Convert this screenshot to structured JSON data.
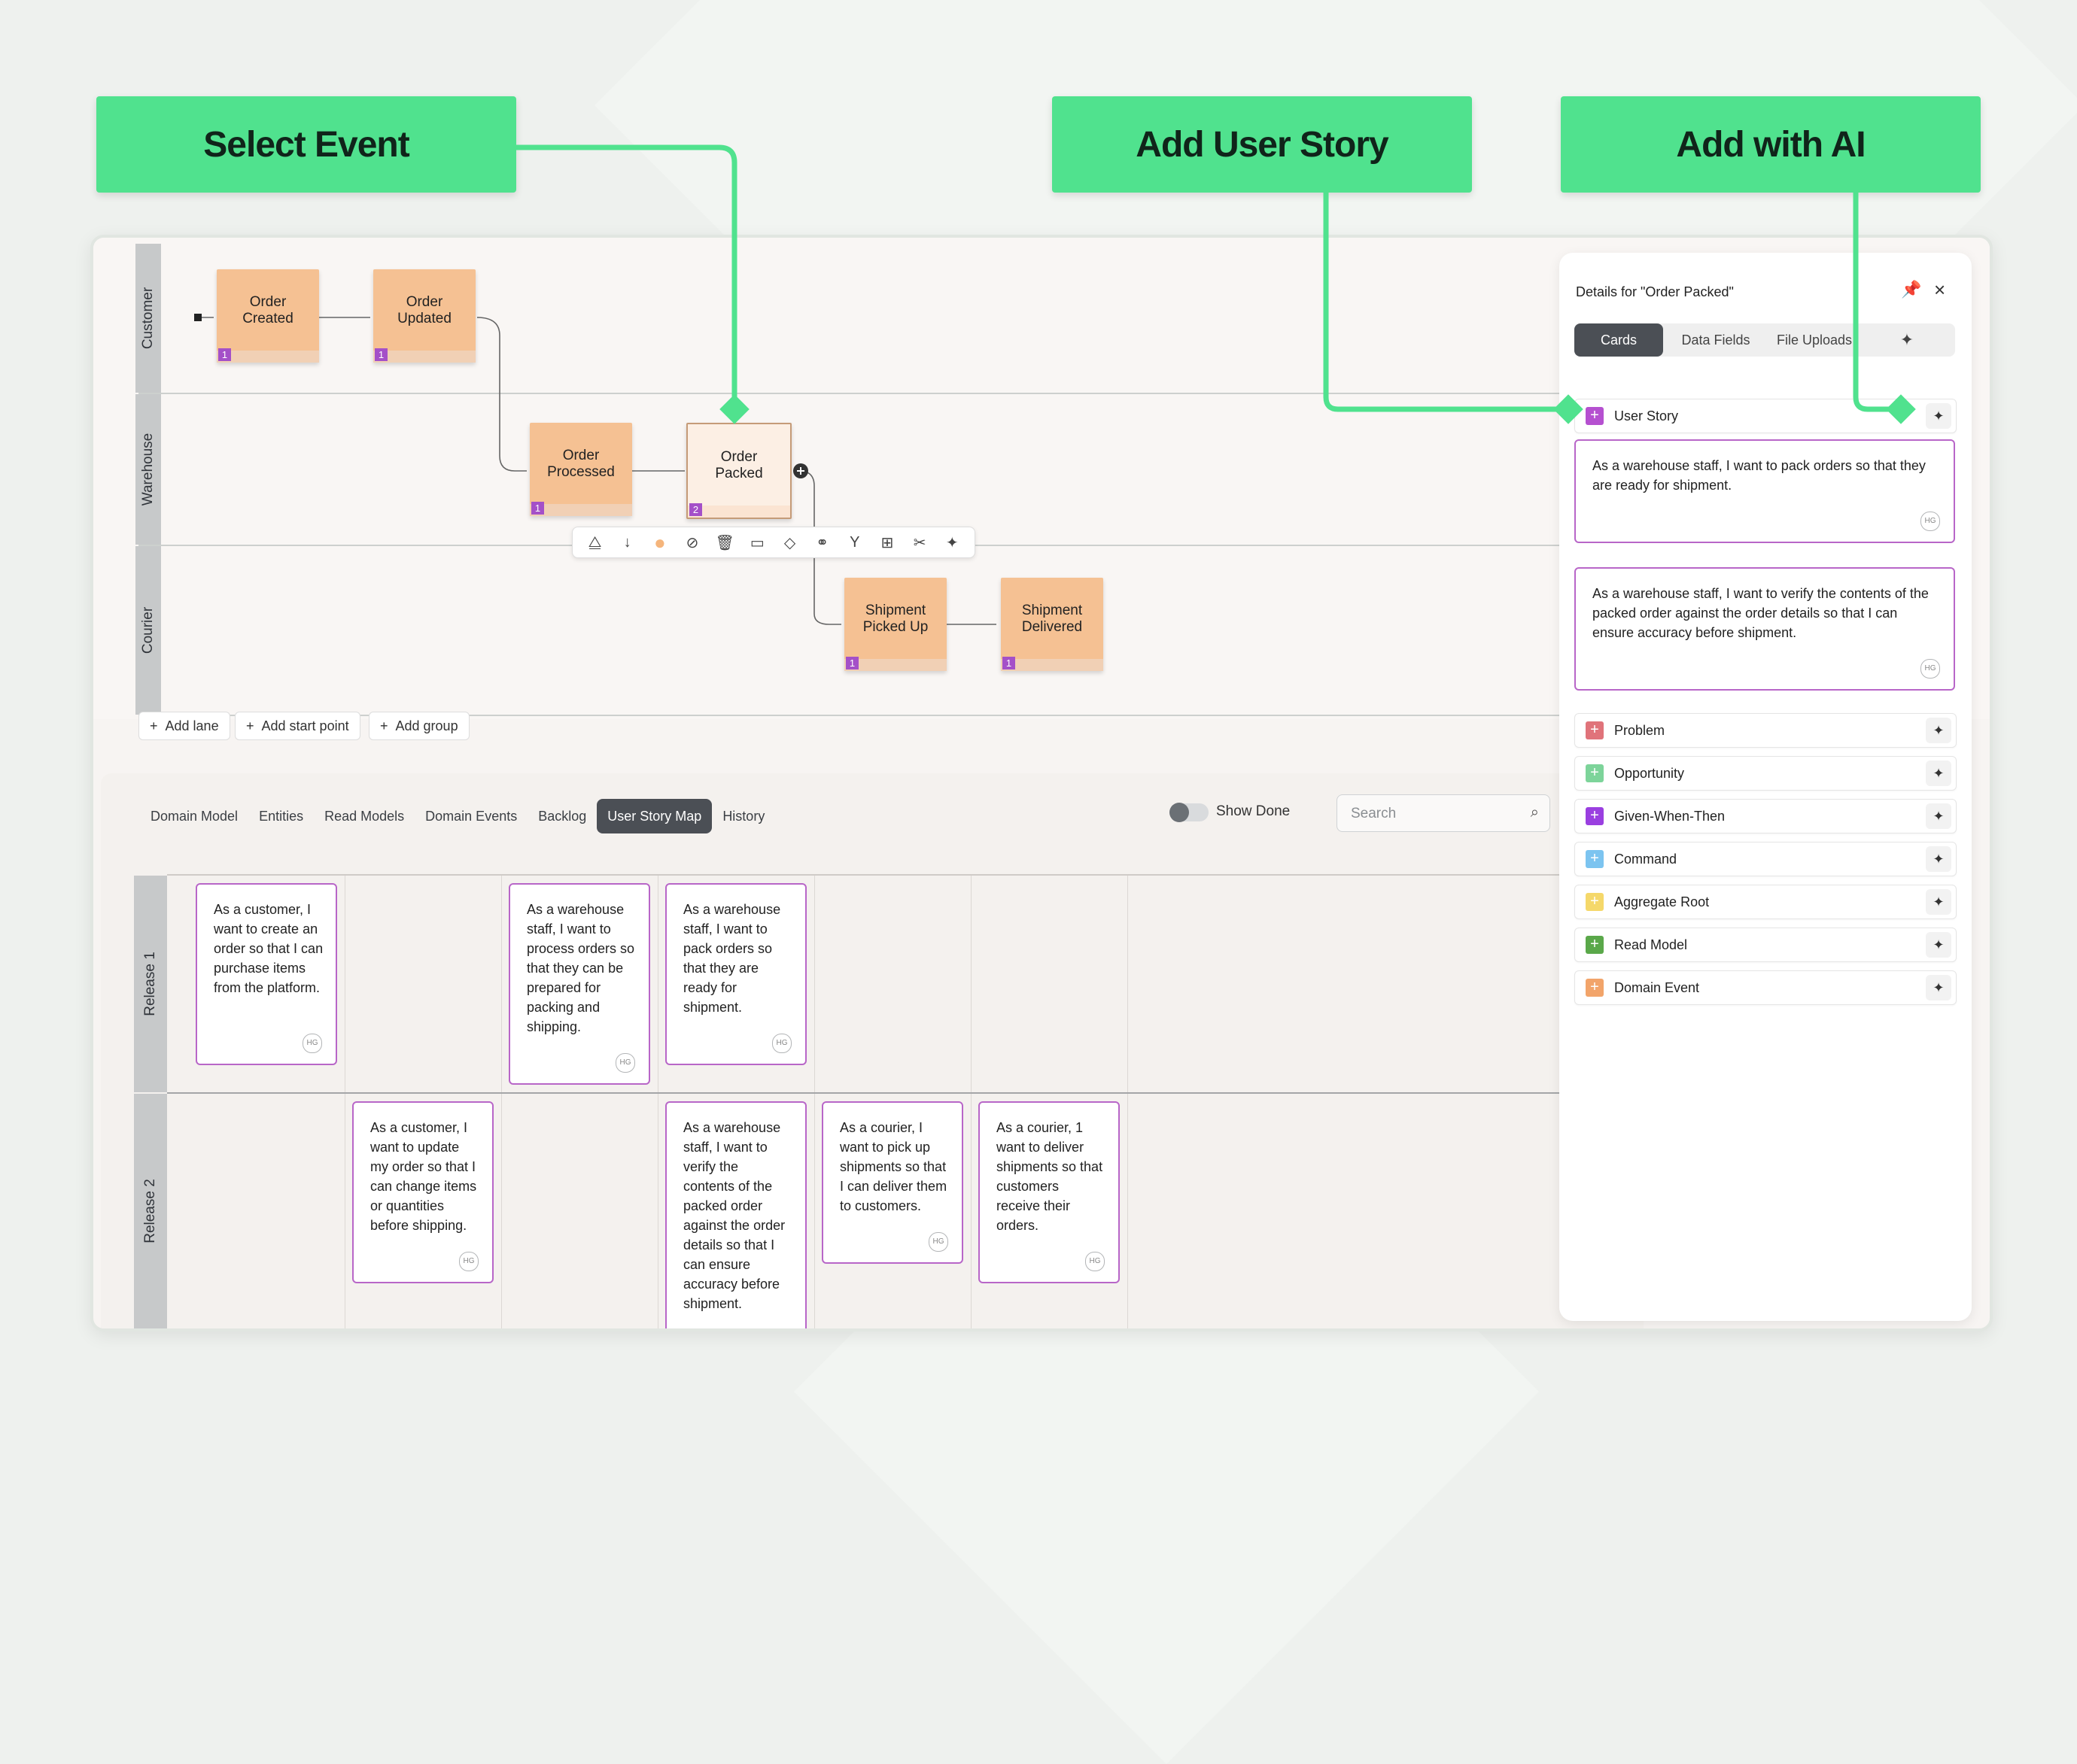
{
  "callouts": {
    "select_event": "Select Event",
    "add_user_story": "Add User Story",
    "add_with_ai": "Add with AI"
  },
  "colors": {
    "accent": "#50e28e",
    "sticky": "#f5c193",
    "badge": "#a450c8",
    "story_border": "#b866c8"
  },
  "lanes": [
    "Customer",
    "Warehouse",
    "Courier"
  ],
  "events": [
    {
      "label": "Order Created",
      "count": "1"
    },
    {
      "label": "Order Updated",
      "count": "1"
    },
    {
      "label": "Order Processed",
      "count": "1"
    },
    {
      "label": "Order Packed",
      "count": "2"
    },
    {
      "label": "Shipment Picked Up",
      "count": "1"
    },
    {
      "label": "Shipment Delivered",
      "count": "1"
    }
  ],
  "toolbar_icons": [
    "shapes-icon",
    "arrow-down-icon",
    "color-dot-icon",
    "unlink-icon",
    "trash-icon",
    "rectangle-icon",
    "diamond-icon",
    "link-icon",
    "branch-icon",
    "add-box-icon",
    "scissors-icon",
    "sparkles-icon"
  ],
  "canvas_actions": {
    "add_lane": "Add lane",
    "add_start_point": "Add start point",
    "add_group": "Add group"
  },
  "tabs": [
    "Domain Model",
    "Entities",
    "Read Models",
    "Domain Events",
    "Backlog",
    "User Story Map",
    "History"
  ],
  "active_tab": "User Story Map",
  "show_done": {
    "label": "Show Done",
    "on": false
  },
  "search": {
    "placeholder": "Search"
  },
  "releases": [
    "Release 1",
    "Release 2"
  ],
  "stories": {
    "r1c1": "As a customer, I want to create an order so that I can purchase items from the platform.",
    "r1c3": "As a warehouse staff, I want to process orders so that they can be prepared for packing and shipping.",
    "r1c4": "As a warehouse staff, I want to pack orders so that they are ready for shipment.",
    "r2c2": "As a customer, I want to update my order so that I can change items or quantities before shipping.",
    "r2c4": "As a warehouse staff, I want to verify the contents of the packed order against the order details so that I can ensure accuracy before shipment.",
    "r2c5": "As a courier, I want to pick up shipments so that I can deliver them to customers.",
    "r2c6": "As a courier, 1 want to deliver shipments so that customers receive their orders.",
    "initials": "HG"
  },
  "panel": {
    "title": "Details for \"Order Packed\"",
    "segments": [
      "Cards",
      "Data Fields",
      "File Uploads"
    ],
    "active_segment": "Cards",
    "user_story_label": "User Story",
    "user_stories": [
      "As a warehouse staff, I want to pack orders so that they are ready for shipment.",
      "As a warehouse staff, I want to verify the contents of the packed order against the order details so that I can ensure accuracy before shipment."
    ],
    "card_types": [
      {
        "label": "Problem",
        "color": "#e0737a"
      },
      {
        "label": "Opportunity",
        "color": "#7dd49a"
      },
      {
        "label": "Given-When-Then",
        "color": "#9a3fe0"
      },
      {
        "label": "Command",
        "color": "#7cc4f0"
      },
      {
        "label": "Aggregate Root",
        "color": "#f5d86a"
      },
      {
        "label": "Read Model",
        "color": "#5aa84a"
      },
      {
        "label": "Domain Event",
        "color": "#f2a46a"
      }
    ],
    "user_story_color": "#b550d0"
  }
}
